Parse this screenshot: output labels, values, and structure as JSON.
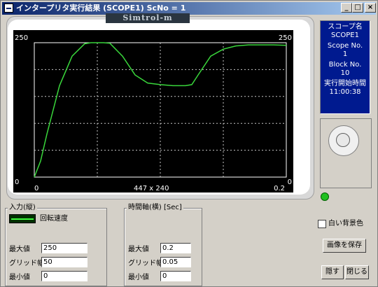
{
  "window": {
    "title": "インタープリタ実行結果 (SCOPE1) ScNo = 1",
    "logo": "Simtrol-m"
  },
  "titlebar_buttons": {
    "minimize": "_",
    "maximize": "□",
    "close": "×"
  },
  "plot": {
    "y_top_left": "250",
    "y_top_right": "250",
    "y_bottom_left": "0",
    "y_bottom_right": "0",
    "x_left": "0",
    "x_right": "0.2",
    "resolution": "447 x 240",
    "trace_color": "#39d63b"
  },
  "chart_data": {
    "type": "line",
    "xlim": [
      0,
      0.2
    ],
    "ylim": [
      0,
      250
    ],
    "grid": true,
    "series": [
      {
        "x": [
          0,
          0.005,
          0.01,
          0.02,
          0.03,
          0.04,
          0.045,
          0.05,
          0.055,
          0.06,
          0.07,
          0.08,
          0.09,
          0.1,
          0.11,
          0.12,
          0.125,
          0.13,
          0.14,
          0.15,
          0.16,
          0.17,
          0.18,
          0.19,
          0.2
        ],
        "y": [
          0,
          30,
          80,
          170,
          225,
          248,
          250,
          250,
          250,
          249,
          225,
          190,
          175,
          172,
          170,
          170,
          172,
          190,
          225,
          238,
          244,
          246,
          246,
          246,
          245
        ]
      }
    ]
  },
  "info_panel": {
    "scope_name_label": "スコープ名",
    "scope_name": "SCOPE1",
    "scope_no_label": "Scope No.",
    "scope_no": "1",
    "block_no_label": "Block No.",
    "block_no": "10",
    "start_time_label": "実行開始時間",
    "start_time": "11:00:38"
  },
  "input_group": {
    "title": "入力(縦)",
    "signal": "回転速度",
    "max_label": "最大値",
    "max": "250",
    "grid_label": "グリッド幅",
    "grid": "50",
    "min_label": "最小値",
    "min": "0"
  },
  "time_group": {
    "title": "時間軸(横) [Sec]",
    "max_label": "最大値",
    "max": "0.2",
    "grid_label": "グリッド幅",
    "grid": "0.05",
    "min_label": "最小値",
    "min": "0"
  },
  "options": {
    "white_bg_label": "白い背景色",
    "save_image": "画像を保存",
    "hide": "隠す",
    "close": "閉じる"
  }
}
